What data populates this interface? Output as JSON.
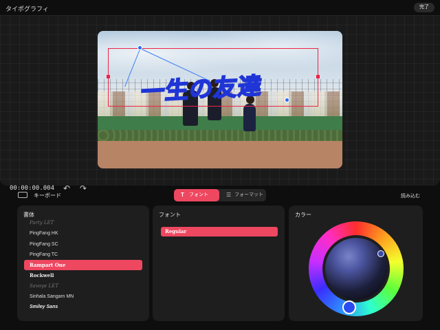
{
  "header": {
    "title": "タイポグラフィ",
    "done_label": "完了"
  },
  "editor": {
    "overlay_text": "一生の友達",
    "timecode": "00:00:00.004"
  },
  "controls": {
    "keyboard_label": "キーボード",
    "tabs": [
      {
        "label": "フォント",
        "active": true
      },
      {
        "label": "フォーマット",
        "active": false
      }
    ],
    "load_label": "読み込む"
  },
  "fonts_panel": {
    "title": "書体",
    "items": [
      "Party LET",
      "PingFang HK",
      "PingFang SC",
      "PingFang TC",
      "Rampart One",
      "Rockwell",
      "Savoye LET",
      "Sinhala Sangam MN",
      "Smiley Sans"
    ],
    "selected": "Rampart One"
  },
  "weight_panel": {
    "title": "フォント",
    "items": [
      "Regular"
    ],
    "selected": "Regular"
  },
  "color_panel": {
    "title": "カラー",
    "accent": "#ee4760",
    "selected_color": "#2a4cf0"
  }
}
